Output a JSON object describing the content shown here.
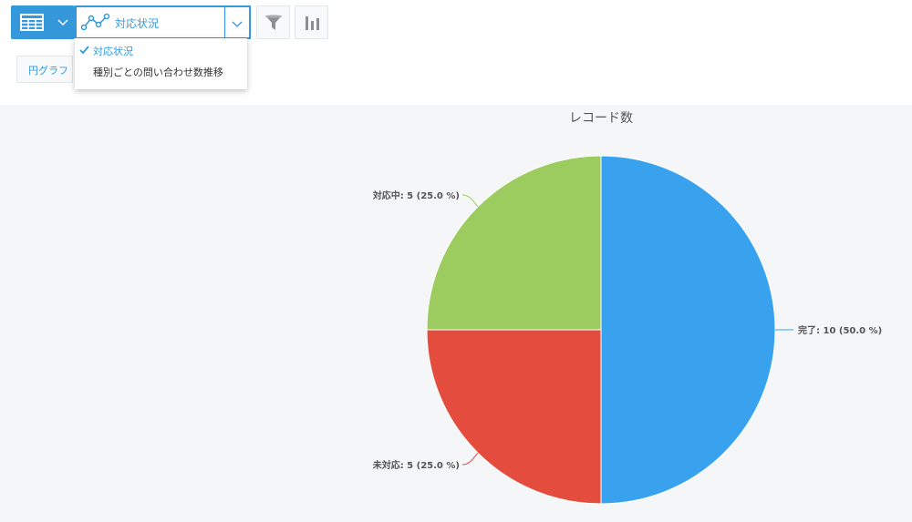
{
  "toolbar": {
    "view_selector_icon": "table-icon",
    "graph_selector": {
      "icon": "line-chart-icon",
      "selected_label": "対応状況"
    },
    "filter_button_icon": "filter-icon",
    "chart_settings_icon": "bar-chart-icon",
    "chart_type_button_label": "円グラフ"
  },
  "dropdown": {
    "items": [
      {
        "label": "対応状況",
        "selected": true
      },
      {
        "label": "種別ごとの問い合わせ数推移",
        "selected": false
      }
    ]
  },
  "colors": {
    "accent": "#3498db",
    "slice_complete": "#38a2ef",
    "slice_in_progress": "#9ccb5f",
    "slice_not_started": "#e44c3d"
  },
  "chart_data": {
    "type": "pie",
    "title": "レコード数",
    "slices": [
      {
        "name": "完了",
        "value": 10,
        "percent": "50.0 %",
        "label": "完了: 10 (50.0 %)",
        "color": "#38a2ef"
      },
      {
        "name": "未対応",
        "value": 5,
        "percent": "25.0 %",
        "label": "未対応: 5 (25.0 %)",
        "color": "#e44c3d"
      },
      {
        "name": "対応中",
        "value": 5,
        "percent": "25.0 %",
        "label": "対応中: 5 (25.0 %)",
        "color": "#9ccb5f"
      }
    ]
  }
}
